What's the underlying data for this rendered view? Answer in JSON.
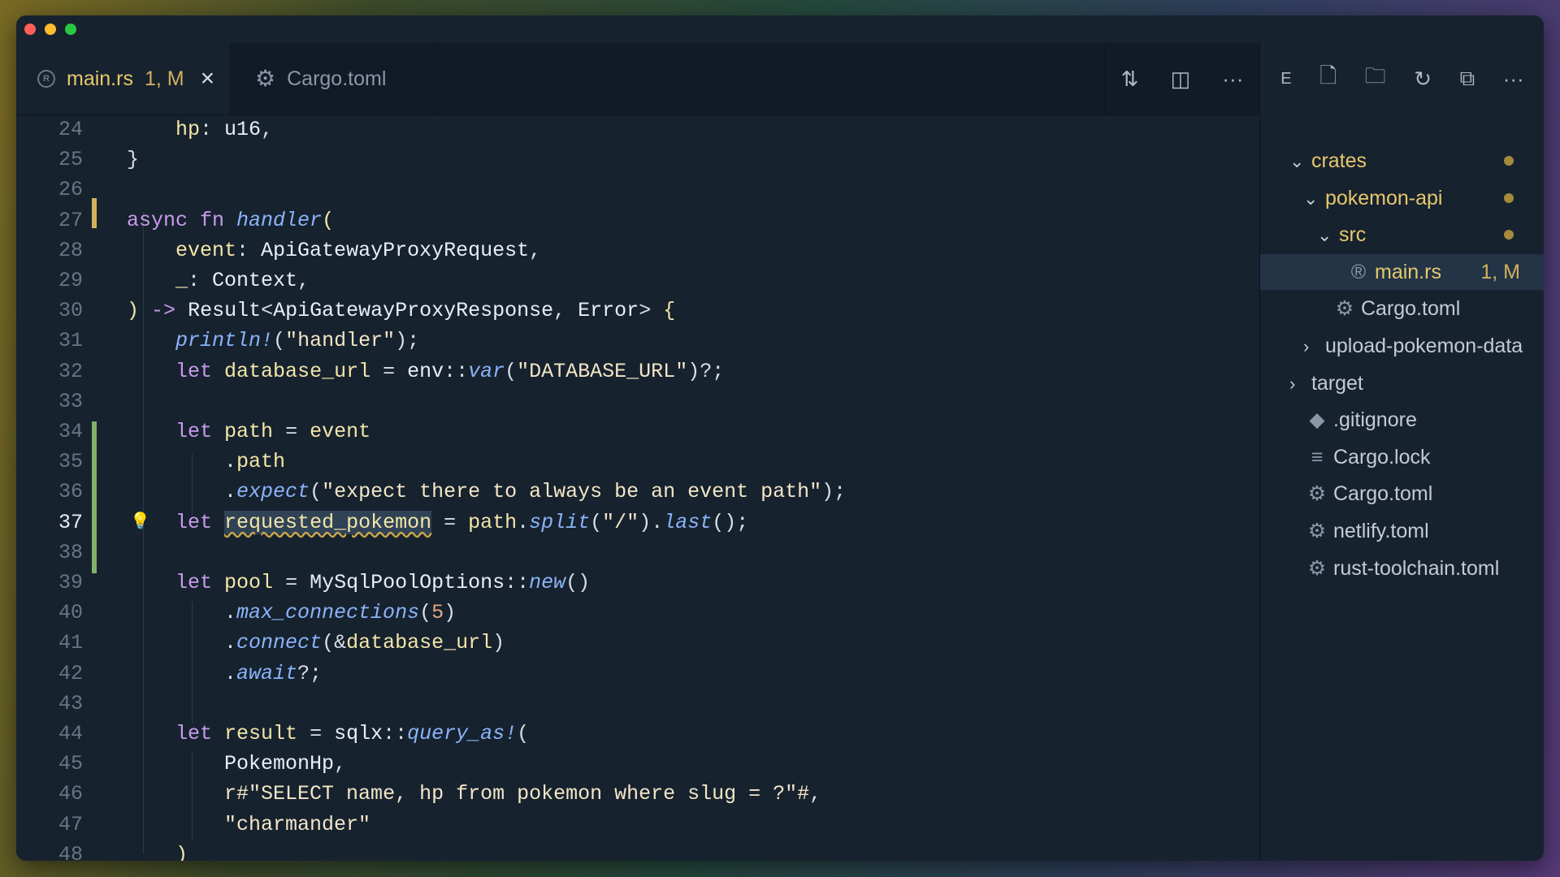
{
  "window_controls": [
    "close",
    "minimize",
    "maximize"
  ],
  "tabs": [
    {
      "label": "main.rs",
      "status": "1, M",
      "active": true,
      "icon": "rust-icon"
    },
    {
      "label": "Cargo.toml",
      "active": false,
      "icon": "gear-icon"
    }
  ],
  "tab_actions": [
    {
      "icon": "compare-changes-icon",
      "glyph": "⇅"
    },
    {
      "icon": "split-editor-icon",
      "glyph": "◫"
    },
    {
      "icon": "more-actions-icon",
      "glyph": "···"
    }
  ],
  "sidebar_actions": [
    {
      "icon": "explorer-label",
      "glyph": "E"
    },
    {
      "icon": "new-file-icon",
      "glyph": "🗋"
    },
    {
      "icon": "new-folder-icon",
      "glyph": "🗀"
    },
    {
      "icon": "refresh-icon",
      "glyph": "↻"
    },
    {
      "icon": "collapse-all-icon",
      "glyph": "⧉"
    },
    {
      "icon": "more-icon",
      "glyph": "···"
    }
  ],
  "current_line": 37,
  "lines": [
    {
      "n": "24",
      "html": "    <span class=\"fld\">hp</span>: <span class=\"ty\">u16</span>,"
    },
    {
      "n": "25",
      "html": "}"
    },
    {
      "n": "26",
      "html": ""
    },
    {
      "n": "27",
      "html": "<span class=\"kw\">async fn</span> <span class=\"fn\">handler</span><span class=\"fld\">(</span>"
    },
    {
      "n": "28",
      "html": "    <span class=\"fld\">event</span>: <span class=\"ty\">ApiGatewayProxyRequest</span>,"
    },
    {
      "n": "29",
      "html": "    <span class=\"fld\">_</span>: <span class=\"ty\">Context</span>,"
    },
    {
      "n": "30",
      "html": "<span class=\"fld\">)</span> <span class=\"kw\">-></span> <span class=\"ty\">Result</span>&lt;<span class=\"ty\">ApiGatewayProxyResponse</span>, <span class=\"ty\">Error</span>&gt; <span class=\"fld\">{</span>"
    },
    {
      "n": "31",
      "html": "    <span class=\"fn\">println!</span>(<span class=\"str\">\"handler\"</span>);"
    },
    {
      "n": "32",
      "html": "    <span class=\"kw\">let</span> <span class=\"fld\">database_url</span> = <span class=\"ty\">env</span>::<span class=\"fn\">var</span>(<span class=\"str\">\"DATABASE_URL\"</span>)?;"
    },
    {
      "n": "33",
      "html": ""
    },
    {
      "n": "34",
      "html": "    <span class=\"kw\">let</span> <span class=\"fld\">path</span> = <span class=\"fld\">event</span>"
    },
    {
      "n": "35",
      "html": "        .<span class=\"fld\">path</span>"
    },
    {
      "n": "36",
      "html": "        .<span class=\"fn\">expect</span>(<span class=\"str\">\"expect there to always be an event path\"</span>);"
    },
    {
      "n": "37",
      "html": "    <span class=\"kw\">let</span> <span class=\"sel\">requested_pokemon</span> = <span class=\"fld\">path</span>.<span class=\"fn\">split</span>(<span class=\"str\">\"/\"</span>).<span class=\"fn\">last</span>();"
    },
    {
      "n": "38",
      "html": ""
    },
    {
      "n": "39",
      "html": "    <span class=\"kw\">let</span> <span class=\"fld\">pool</span> = <span class=\"ty\">MySqlPoolOptions</span>::<span class=\"fn\">new</span>()"
    },
    {
      "n": "40",
      "html": "        .<span class=\"fn\">max_connections</span>(<span class=\"num\">5</span>)"
    },
    {
      "n": "41",
      "html": "        .<span class=\"fn\">connect</span>(&amp;<span class=\"fld\">database_url</span>)"
    },
    {
      "n": "42",
      "html": "        .<span class=\"fn\">await</span>?;"
    },
    {
      "n": "43",
      "html": ""
    },
    {
      "n": "44",
      "html": "    <span class=\"kw\">let</span> <span class=\"fld\">result</span> = <span class=\"ty\">sqlx</span>::<span class=\"fn\">query_as!</span>("
    },
    {
      "n": "45",
      "html": "        <span class=\"ty\">PokemonHp</span>,"
    },
    {
      "n": "46",
      "html": "        <span class=\"str\">r#\"SELECT name, hp from pokemon where slug = ?\"#</span>,"
    },
    {
      "n": "47",
      "html": "        <span class=\"str\">\"charmander\"</span>"
    },
    {
      "n": "48",
      "html": "    <span class=\"fld\">)</span>"
    }
  ],
  "tree": [
    {
      "label": "crates",
      "chev": "⌄",
      "icon": "",
      "depth": 0,
      "yellow": true,
      "dot": true
    },
    {
      "label": "pokemon-api",
      "chev": "⌄",
      "icon": "",
      "depth": 1,
      "yellow": true,
      "dot": true
    },
    {
      "label": "src",
      "chev": "⌄",
      "icon": "",
      "depth": 2,
      "yellow": true,
      "dot": true
    },
    {
      "label": "main.rs",
      "chev": "",
      "icon": "®",
      "depth": 3,
      "yellow": true,
      "badge": "1, M",
      "selected": true
    },
    {
      "label": "Cargo.toml",
      "chev": "",
      "icon": "⚙",
      "depth": 2
    },
    {
      "label": "upload-pokemon-data",
      "chev": "›",
      "icon": "",
      "depth": 1
    },
    {
      "label": "target",
      "chev": "›",
      "icon": "",
      "depth": 0
    },
    {
      "label": ".gitignore",
      "chev": "",
      "icon": "◆",
      "depth": 0
    },
    {
      "label": "Cargo.lock",
      "chev": "",
      "icon": "≡",
      "depth": 0
    },
    {
      "label": "Cargo.toml",
      "chev": "",
      "icon": "⚙",
      "depth": 0
    },
    {
      "label": "netlify.toml",
      "chev": "",
      "icon": "⚙",
      "depth": 0
    },
    {
      "label": "rust-toolchain.toml",
      "chev": "",
      "icon": "⚙",
      "depth": 0
    }
  ],
  "colors": {
    "editor_bg": "#17222f",
    "modified_gutter": "#d2b15a",
    "added_gutter": "#7fb26a",
    "accent_yellow": "#e6c86b"
  }
}
